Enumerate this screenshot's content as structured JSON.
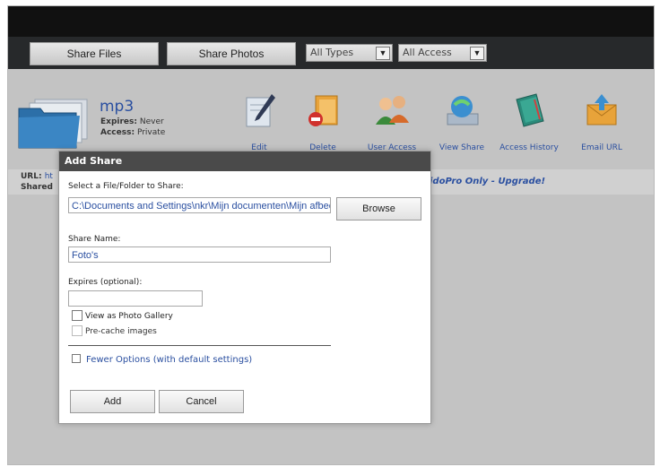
{
  "toolbar": {
    "share_files_label": "Share Files",
    "share_photos_label": "Share Photos",
    "type_select_value": "All Types",
    "access_select_value": "All Access"
  },
  "share": {
    "name": "mp3",
    "expires_label": "Expires:",
    "expires_value": "Never",
    "access_label": "Access:",
    "access_value": "Private",
    "url_label": "URL:",
    "url_value": "ht",
    "shared_label": "Shared",
    "upgrade_text": "idoPro Only - Upgrade!"
  },
  "actions": [
    {
      "label": "Edit"
    },
    {
      "label": "Delete"
    },
    {
      "label": "User Access"
    },
    {
      "label": "View Share"
    },
    {
      "label": "Access History"
    },
    {
      "label": "Email URL"
    }
  ],
  "dialog": {
    "title": "Add Share",
    "select_label": "Select a File/Folder to Share:",
    "path_value": "C:\\Documents and Settings\\nkr\\Mijn documenten\\Mijn afbeeld",
    "browse_label": "Browse",
    "share_name_label": "Share Name:",
    "share_name_value": "Foto's",
    "expires_label": "Expires (optional):",
    "expires_value": "",
    "photo_gallery_label": "View as Photo Gallery",
    "precache_label": "Pre-cache images",
    "fewer_options_label": "Fewer Options (with default settings)",
    "add_label": "Add",
    "cancel_label": "Cancel"
  }
}
